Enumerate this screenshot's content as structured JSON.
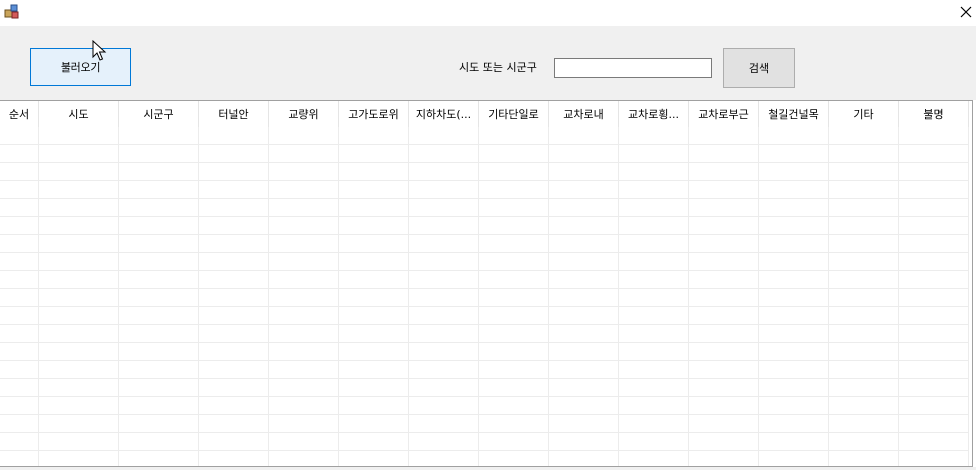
{
  "toolbar": {
    "load_label": "불러오기",
    "search_label": "시도 또는 시군구",
    "search_value": "",
    "search_button": "검색"
  },
  "grid": {
    "columns": [
      "순서",
      "시도",
      "시군구",
      "터널안",
      "교량위",
      "고가도로위",
      "지하차도(...",
      "기타단일로",
      "교차로내",
      "교차로횡...",
      "교차로부근",
      "철길건널목",
      "기타",
      "불명"
    ],
    "rows": []
  },
  "icons": {
    "app": "app-icon",
    "close": "close-icon",
    "cursor": "mouse-pointer-icon"
  },
  "colors": {
    "toolbar_bg": "#f0f0f0",
    "focus_border": "#0078d7"
  }
}
